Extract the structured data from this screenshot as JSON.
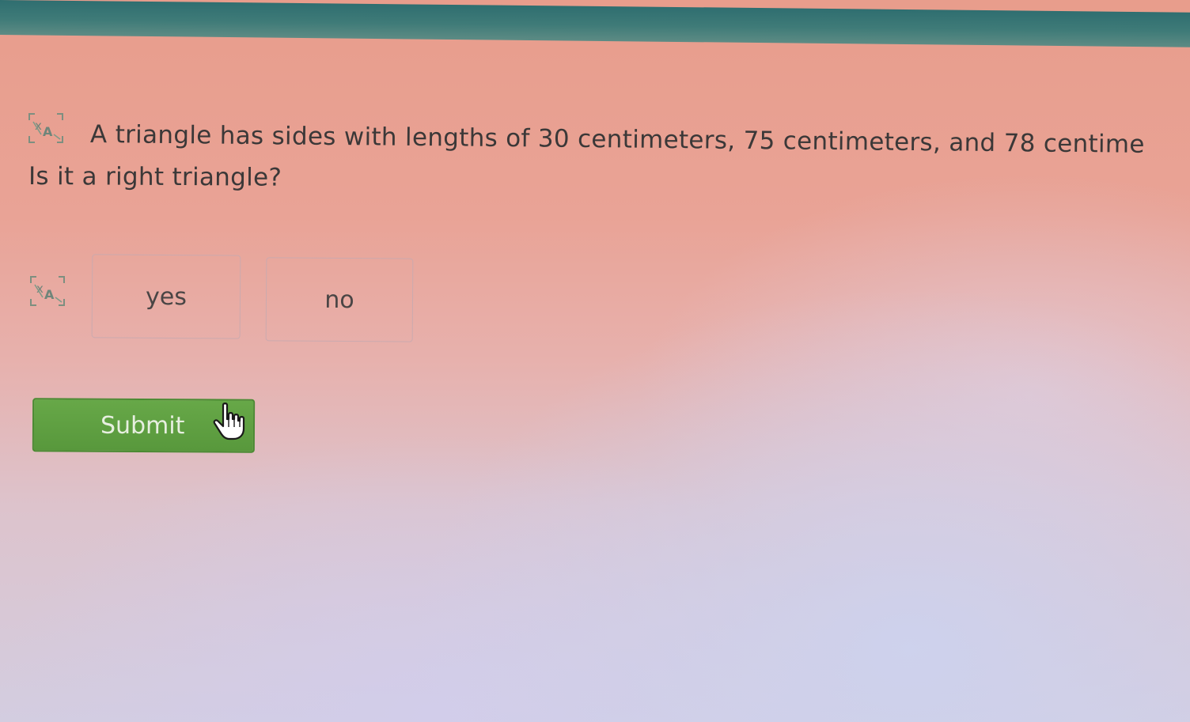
{
  "question": {
    "line1": "A triangle has sides with lengths of 30 centimeters, 75 centimeters, and 78 centime",
    "line2": "Is it a right triangle?",
    "audio_icon": "speaker-translate-icon"
  },
  "choices": {
    "audio_icon": "speaker-translate-icon",
    "items": [
      {
        "label": "yes"
      },
      {
        "label": "no"
      }
    ]
  },
  "submit": {
    "label": "Submit",
    "color": "#5e9f42"
  },
  "cursor": {
    "icon": "hand-pointer-icon"
  },
  "colors": {
    "top_bar": "#3a7674",
    "text": "#3b3838"
  }
}
